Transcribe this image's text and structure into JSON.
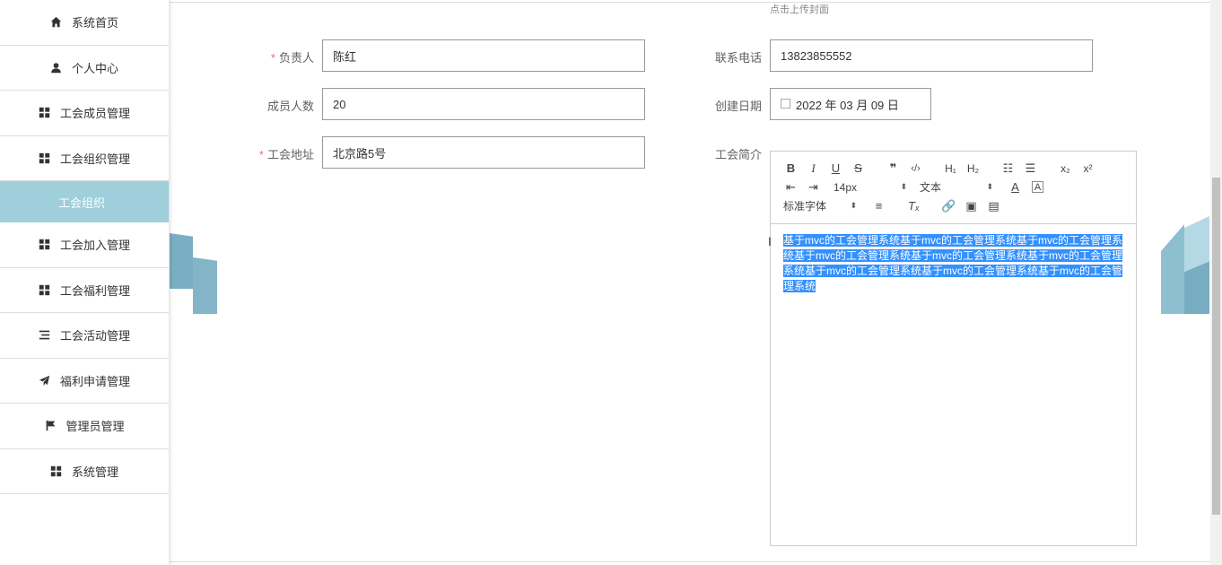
{
  "sidebar": {
    "items": [
      {
        "label": "系统首页",
        "icon": "home-icon"
      },
      {
        "label": "个人中心",
        "icon": "user-icon"
      },
      {
        "label": "工会成员管理",
        "icon": "grid-icon"
      },
      {
        "label": "工会组织管理",
        "icon": "grid-icon"
      },
      {
        "label": "工会加入管理",
        "icon": "grid-icon"
      },
      {
        "label": "工会福利管理",
        "icon": "grid-icon"
      },
      {
        "label": "工会活动管理",
        "icon": "list-icon"
      },
      {
        "label": "福利申请管理",
        "icon": "send-icon"
      },
      {
        "label": "管理员管理",
        "icon": "flag-icon"
      },
      {
        "label": "系统管理",
        "icon": "grid-icon"
      }
    ],
    "active_sub": "工会组织"
  },
  "upload": {
    "hint": "点击上传封面"
  },
  "form": {
    "fuzeren": {
      "label": "负责人",
      "value": "陈红",
      "required": "*"
    },
    "phone": {
      "label": "联系电话",
      "value": "13823855552"
    },
    "members": {
      "label": "成员人数",
      "value": "20"
    },
    "date": {
      "label": "创建日期",
      "value": "2022 年 03 月 09 日"
    },
    "address": {
      "label": "工会地址",
      "value": "北京路5号",
      "required": "*"
    },
    "intro": {
      "label": "工会简介"
    }
  },
  "editor": {
    "font_size": "14px",
    "header": "文本",
    "font_family": "标准字体",
    "content": "基于mvc的工会管理系统基于mvc的工会管理系统基于mvc的工会管理系统基于mvc的工会管理系统基于mvc的工会管理系统基于mvc的工会管理系统基于mvc的工会管理系统基于mvc的工会管理系统基于mvc的工会管理系统"
  },
  "colors": {
    "accent": "#9ecfdb",
    "selection": "#3390ff",
    "required": "#f56c6c"
  }
}
